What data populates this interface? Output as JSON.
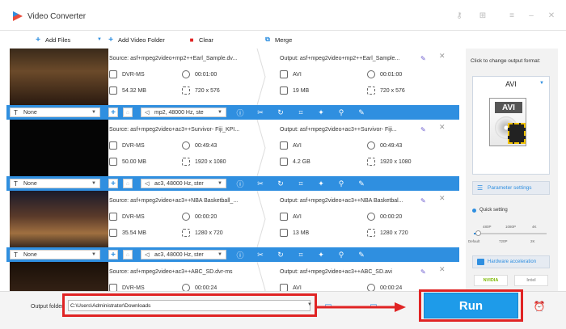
{
  "app": {
    "title": "Video Converter"
  },
  "window_controls": [
    "key-icon",
    "cart-icon",
    "menu-icon",
    "minimize-icon",
    "close-icon"
  ],
  "toolbar": {
    "add_files": "Add Files",
    "add_video_folder": "Add Video Folder",
    "clear": "Clear",
    "merge": "Merge"
  },
  "files": [
    {
      "source": "Source: asf+mpeg2video+mp2++Earl_Sample.dv...",
      "src_format": "DVR-MS",
      "src_duration": "00:01:00",
      "src_size": "54.32 MB",
      "src_res": "720 x 576",
      "output": "Output: asf+mpeg2video+mp2++Earl_Sample...",
      "out_format": "AVI",
      "out_duration": "00:01:00",
      "out_size": "19 MB",
      "out_res": "720 x 576",
      "subtitle": "None",
      "audio": "mp2, 48000 Hz, ste"
    },
    {
      "source": "Source: asf+mpeg2video+ac3++Survivor- Fiji_KPI...",
      "src_format": "DVR-MS",
      "src_duration": "00:49:43",
      "src_size": "50.00 MB",
      "src_res": "1920 x 1080",
      "output": "Output: asf+mpeg2video+ac3++Survivor- Fiji...",
      "out_format": "AVI",
      "out_duration": "00:49:43",
      "out_size": "4.2 GB",
      "out_res": "1920 x 1080",
      "subtitle": "None",
      "audio": "ac3, 48000 Hz, ster"
    },
    {
      "source": "Source: asf+mpeg2video+ac3++NBA Basketball_...",
      "src_format": "DVR-MS",
      "src_duration": "00:00:20",
      "src_size": "35.54 MB",
      "src_res": "1280 x 720",
      "output": "Output: asf+mpeg2video+ac3++NBA Basketbal...",
      "out_format": "AVI",
      "out_duration": "00:00:20",
      "out_size": "13 MB",
      "out_res": "1280 x 720",
      "subtitle": "None",
      "audio": "ac3, 48000 Hz, ster"
    },
    {
      "source": "Source: asf+mpeg2video+ac3++ABC_SD.dvr-ms",
      "src_format": "DVR-MS",
      "src_duration": "00:00:24",
      "src_size": "",
      "src_res": "",
      "output": "Output: asf+mpeg2video+ac3++ABC_SD.avi",
      "out_format": "AVI",
      "out_duration": "00:00:24",
      "out_size": "",
      "out_res": "",
      "subtitle": "None",
      "audio": "ac3, 48000 Hz, ster"
    }
  ],
  "right_panel": {
    "hint": "Click to change output format:",
    "format": "AVI",
    "badge": "AVI",
    "parameter_settings": "Parameter settings",
    "quick_setting": "Quick setting",
    "ticks_top": [
      "480P",
      "1080P",
      "4K"
    ],
    "ticks_bottom": [
      "Default",
      "720P",
      "2K"
    ],
    "quality_level": 0.05,
    "hardware_acceleration": "Hardware acceleration",
    "gpu_labels": [
      "NVIDIA",
      "Intel"
    ]
  },
  "bottom": {
    "output_folder_label": "Output folder:",
    "output_folder_value": "C:\\Users\\Administrator\\Downloads",
    "run": "Run"
  },
  "colors": {
    "accent": "#2f8fe0",
    "run": "#1e9be9",
    "highlight": "#e02424"
  }
}
